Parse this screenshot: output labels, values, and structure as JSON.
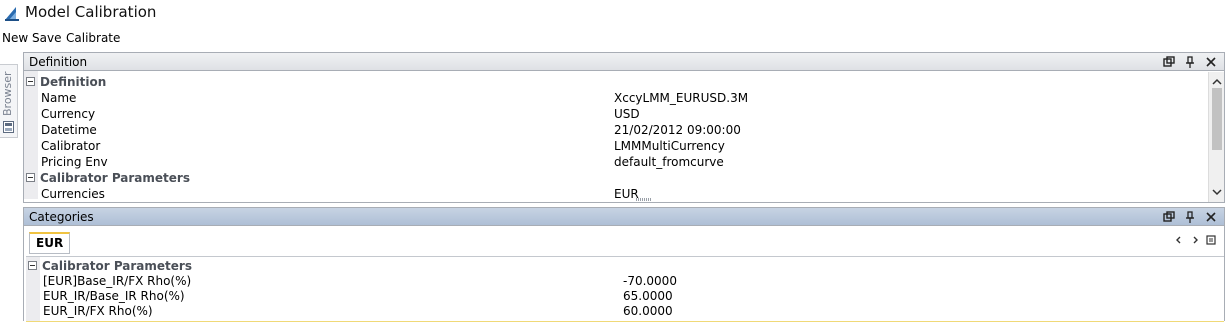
{
  "window": {
    "title": "Model Calibration"
  },
  "menu": {
    "items": [
      "New",
      "Save",
      "Calibrate"
    ]
  },
  "browser": {
    "label": "Browser"
  },
  "definition_panel": {
    "title": "Definition",
    "categories": [
      {
        "label": "Definition",
        "properties": [
          {
            "name": "Name",
            "value": "XccyLMM_EURUSD.3M"
          },
          {
            "name": "Currency",
            "value": "USD"
          },
          {
            "name": "Datetime",
            "value": "21/02/2012 09:00:00"
          },
          {
            "name": "Calibrator",
            "value": "LMMMultiCurrency"
          },
          {
            "name": "Pricing Env",
            "value": "default_fromcurve"
          }
        ]
      },
      {
        "label": "Calibrator Parameters",
        "properties": [
          {
            "name": "Currencies",
            "value": "EUR"
          }
        ]
      }
    ]
  },
  "categories_panel": {
    "title": "Categories",
    "tabs": [
      "EUR"
    ],
    "category": {
      "label": "Calibrator Parameters"
    },
    "properties": [
      {
        "name": "[EUR]Base_IR/FX Rho(%)",
        "value": "-70.0000"
      },
      {
        "name": "EUR_IR/Base_IR Rho(%)",
        "value": "65.0000"
      },
      {
        "name": "EUR_IR/FX Rho(%)",
        "value": "60.0000"
      }
    ]
  },
  "colors": {
    "header_active": "#aebfd6",
    "header_inactive": "#dfe1e5",
    "tab_accent": "#f0c341",
    "category_text": "#4a4f57",
    "logo_blue": "#2b6cb0"
  }
}
